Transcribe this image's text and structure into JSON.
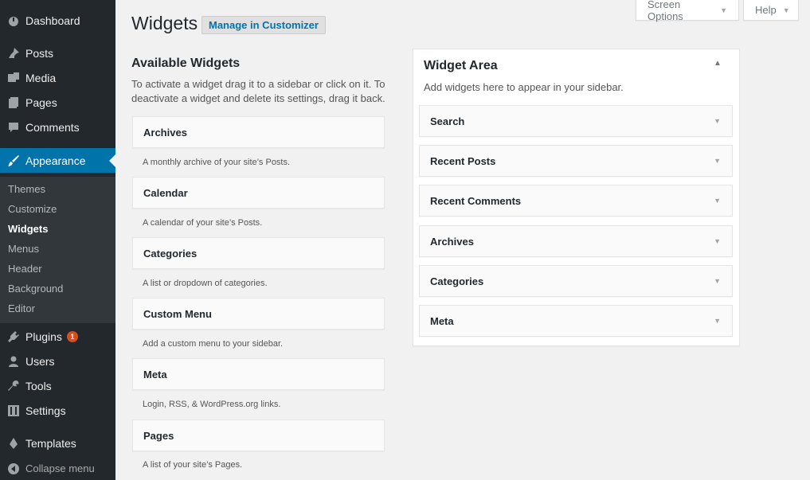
{
  "sidebar": {
    "items": [
      {
        "label": "Dashboard",
        "icon": "dashboard-icon"
      },
      {
        "label": "Posts",
        "icon": "pin-icon"
      },
      {
        "label": "Media",
        "icon": "media-icon"
      },
      {
        "label": "Pages",
        "icon": "pages-icon"
      },
      {
        "label": "Comments",
        "icon": "comment-icon"
      },
      {
        "label": "Appearance",
        "icon": "brush-icon"
      },
      {
        "label": "Plugins",
        "icon": "plug-icon",
        "badge": "1"
      },
      {
        "label": "Users",
        "icon": "user-icon"
      },
      {
        "label": "Tools",
        "icon": "wrench-icon"
      },
      {
        "label": "Settings",
        "icon": "settings-icon"
      },
      {
        "label": "Templates",
        "icon": "pen-icon"
      }
    ],
    "submenu": [
      "Themes",
      "Customize",
      "Widgets",
      "Menus",
      "Header",
      "Background",
      "Editor"
    ],
    "collapse_label": "Collapse menu"
  },
  "top": {
    "screen_options": "Screen Options",
    "help": "Help"
  },
  "header": {
    "title": "Widgets",
    "customizer_button": "Manage in Customizer"
  },
  "available": {
    "title": "Available Widgets",
    "description": "To activate a widget drag it to a sidebar or click on it. To deactivate a widget and delete its settings, drag it back.",
    "widgets": [
      {
        "name": "Archives",
        "desc": "A monthly archive of your site’s Posts."
      },
      {
        "name": "Calendar",
        "desc": "A calendar of your site’s Posts."
      },
      {
        "name": "Categories",
        "desc": "A list or dropdown of categories."
      },
      {
        "name": "Custom Menu",
        "desc": "Add a custom menu to your sidebar."
      },
      {
        "name": "Meta",
        "desc": "Login, RSS, & WordPress.org links."
      },
      {
        "name": "Pages",
        "desc": "A list of your site’s Pages."
      }
    ]
  },
  "area": {
    "title": "Widget Area",
    "description": "Add widgets here to appear in your sidebar.",
    "widgets": [
      "Search",
      "Recent Posts",
      "Recent Comments",
      "Archives",
      "Categories",
      "Meta"
    ]
  },
  "colors": {
    "sidebar_bg": "#23282d",
    "accent": "#0073aa",
    "badge": "#d54e21"
  }
}
